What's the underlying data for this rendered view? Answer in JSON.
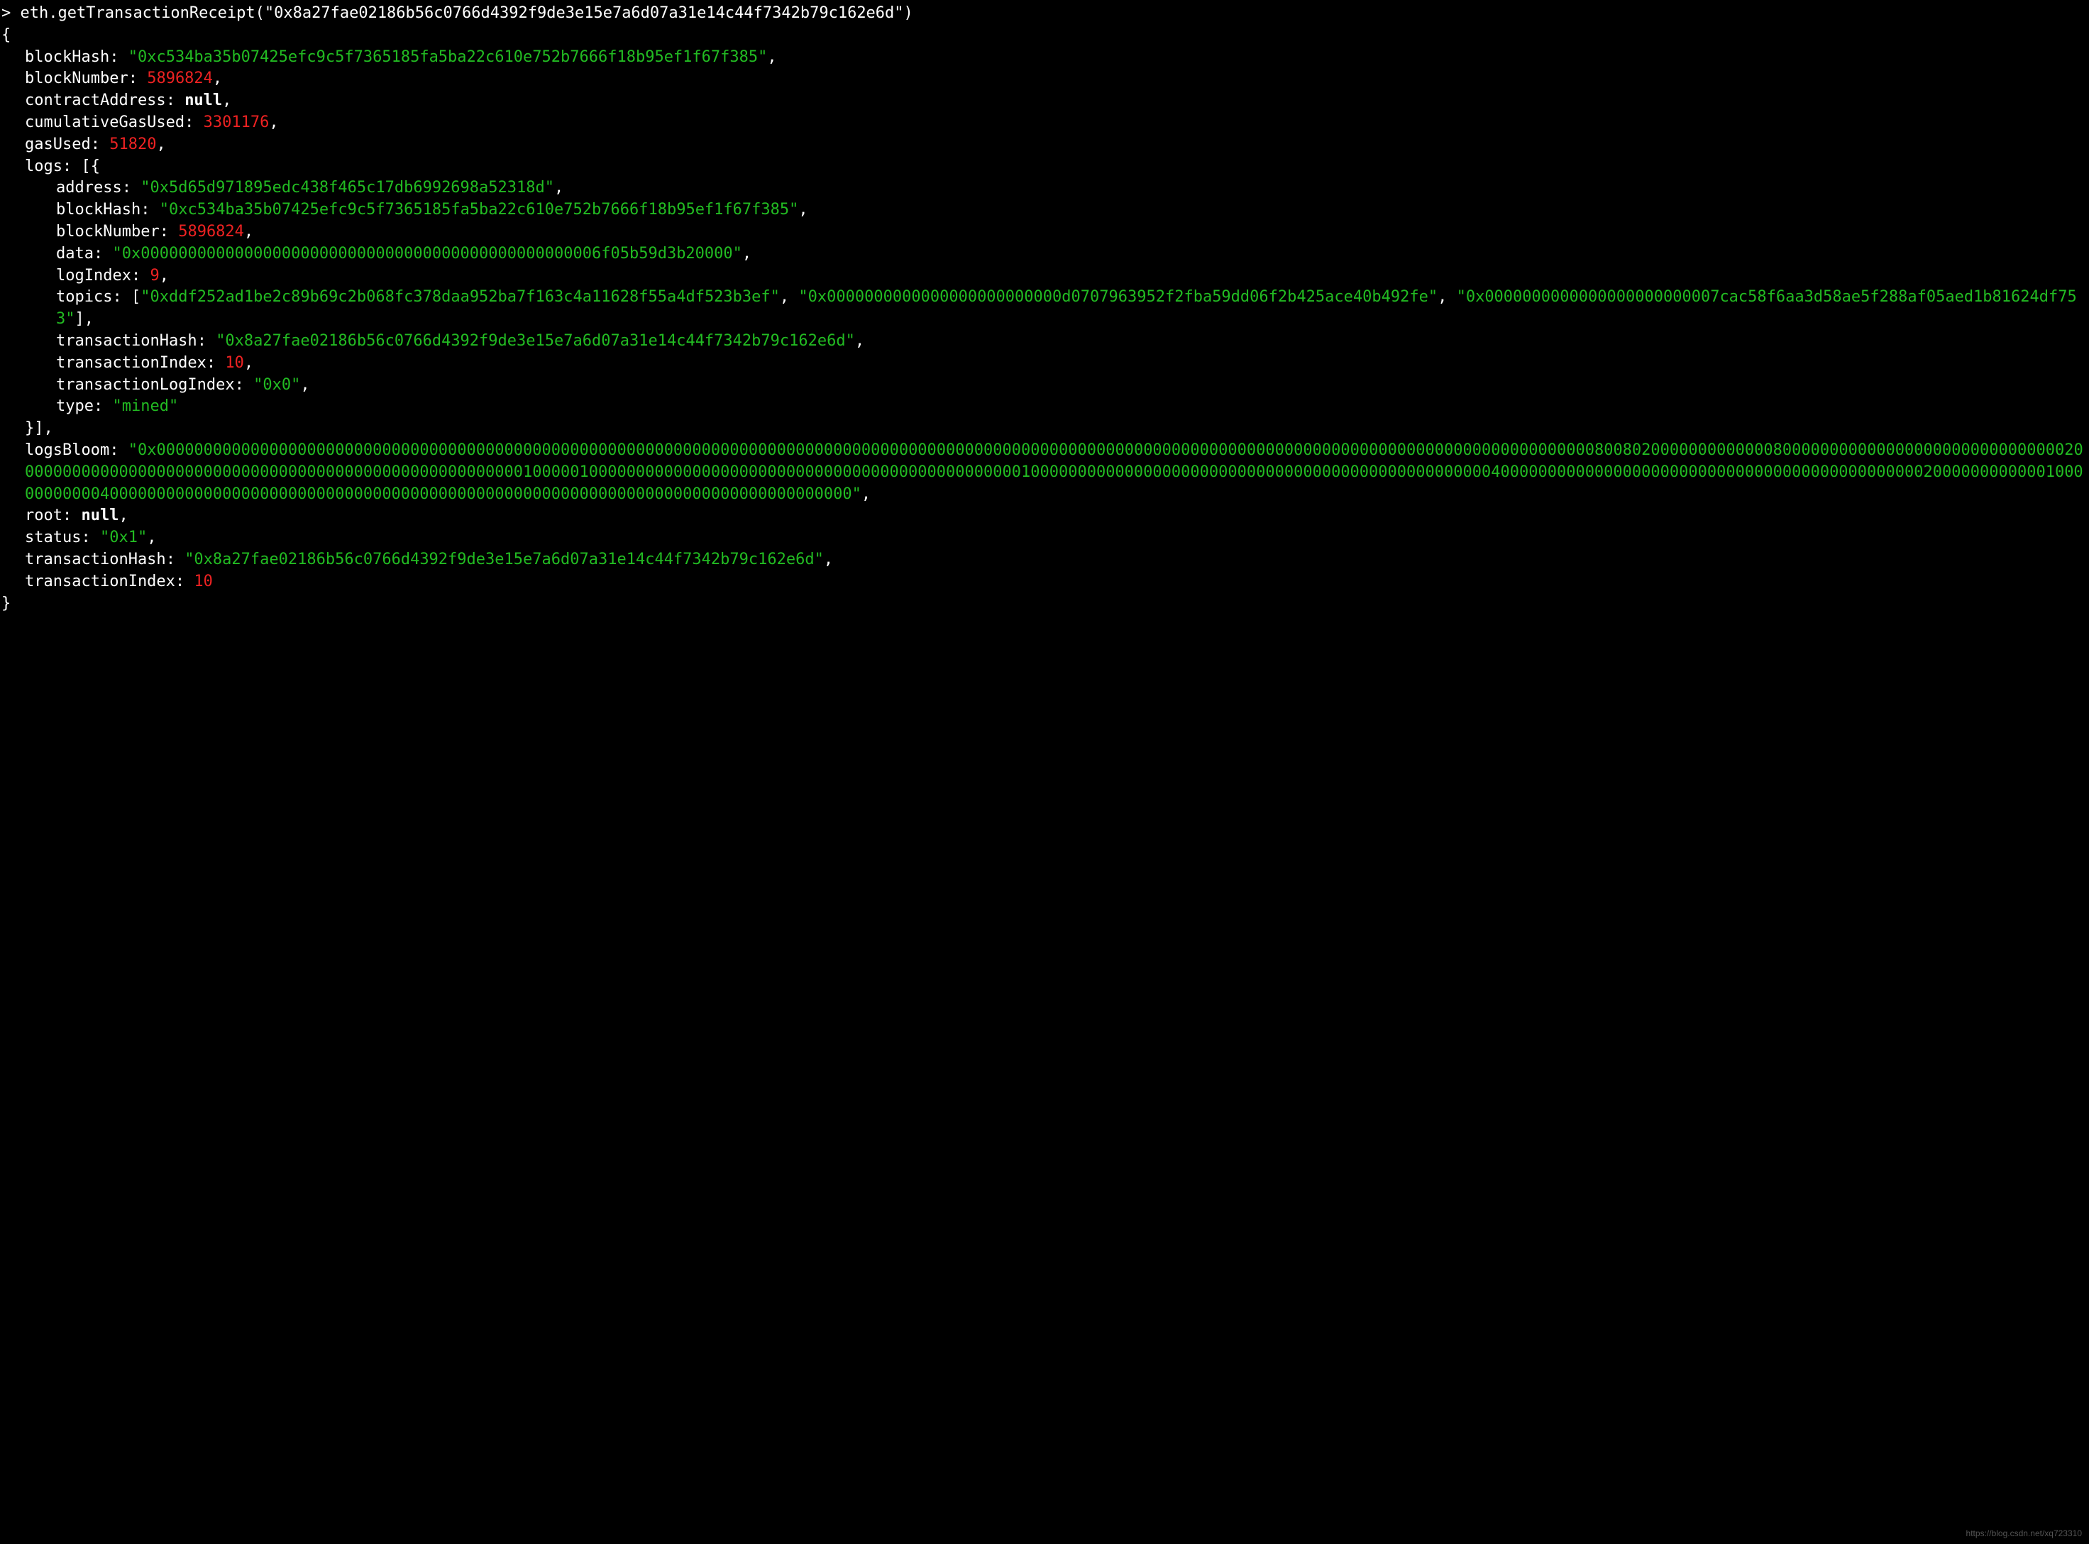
{
  "prompt": "> ",
  "command": "eth.getTransactionReceipt(\"0x8a27fae02186b56c0766d4392f9de3e15e7a6d07a31e14c44f7342b79c162e6d\")",
  "receipt": {
    "blockHash": "\"0xc534ba35b07425efc9c5f7365185fa5ba22c610e752b7666f18b95ef1f67f385\"",
    "blockNumber": "5896824",
    "contractAddress": "null",
    "cumulativeGasUsed": "3301176",
    "gasUsed": "51820",
    "log": {
      "address": "\"0x5d65d971895edc438f465c17db6992698a52318d\"",
      "blockHash": "\"0xc534ba35b07425efc9c5f7365185fa5ba22c610e752b7666f18b95ef1f67f385\"",
      "blockNumber": "5896824",
      "data": "\"0x0000000000000000000000000000000000000000000000006f05b59d3b20000\"",
      "logIndex": "9",
      "topic0": "\"0xddf252ad1be2c89b69c2b068fc378daa952ba7f163c4a11628f55a4df523b3ef\"",
      "topic1": "\"0x0000000000000000000000000d0707963952f2fba59dd06f2b425ace40b492fe\"",
      "topic2": "\"0x0000000000000000000000007cac58f6aa3d58ae5f288af05aed1b81624df753\"",
      "transactionHash": "\"0x8a27fae02186b56c0766d4392f9de3e15e7a6d07a31e14c44f7342b79c162e6d\"",
      "transactionIndex": "10",
      "transactionLogIndex": "\"0x0\"",
      "type": "\"mined\""
    },
    "logsBloom": "\"0x00000000000000000000000000000000000000000000000000000000000000000000000000000000000000000000000000000000000000000000000000000000000000000000000000000000080080200000000000008000000000000000000000000000000200000000000000000000000000000000000000000000000000000010000010000000000000000000000000000000000000000000000100000000000000000000000000000000000000000000000004000000000000000000000000000000000000000000000200000000000010000000000040000000000000000000000000000000000000000000000000000000000000000000000000000000\"",
    "root": "null",
    "status": "\"0x1\"",
    "transactionHash": "\"0x8a27fae02186b56c0766d4392f9de3e15e7a6d07a31e14c44f7342b79c162e6d\"",
    "transactionIndex": "10"
  },
  "labels": {
    "blockHash": "blockHash",
    "blockNumber": "blockNumber",
    "contractAddress": "contractAddress",
    "cumulativeGasUsed": "cumulativeGasUsed",
    "gasUsed": "gasUsed",
    "logs": "logs",
    "address": "address",
    "data": "data",
    "logIndex": "logIndex",
    "topics": "topics",
    "transactionHash": "transactionHash",
    "transactionIndex": "transactionIndex",
    "transactionLogIndex": "transactionLogIndex",
    "type": "type",
    "logsBloom": "logsBloom",
    "root": "root",
    "status": "status"
  },
  "watermark": "https://blog.csdn.net/xq723310"
}
